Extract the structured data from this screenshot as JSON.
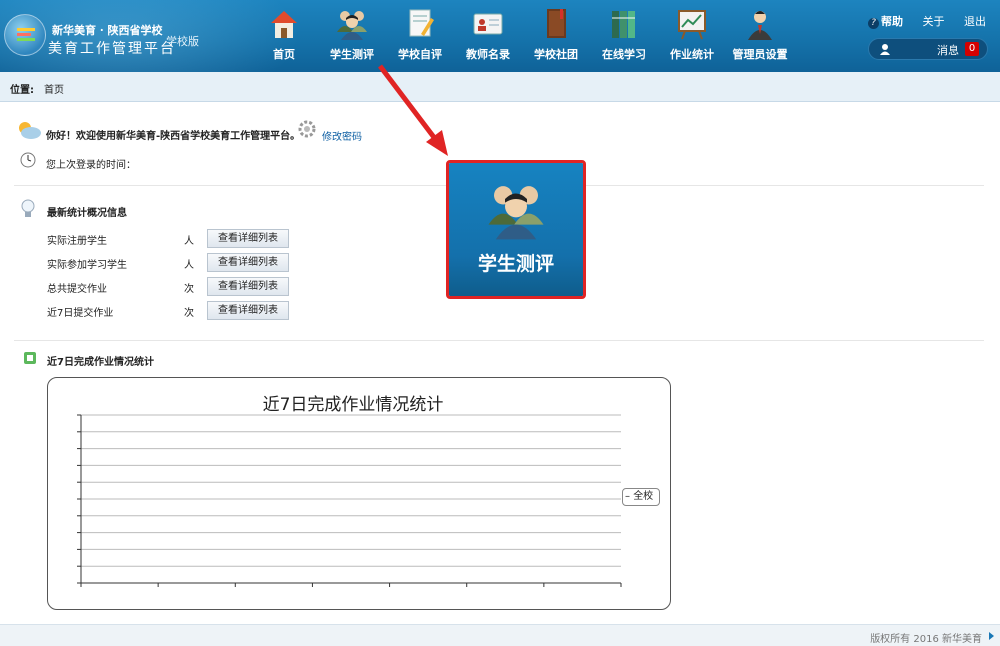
{
  "header": {
    "brand_line1": "新华美育 · 陕西省学校",
    "brand_line2": "美育工作管理平台",
    "edition": "学校版",
    "nav": [
      {
        "label": "首页",
        "icon": "home-icon"
      },
      {
        "label": "学生测评",
        "icon": "students-icon"
      },
      {
        "label": "学校自评",
        "icon": "self-evaluation-icon"
      },
      {
        "label": "教师名录",
        "icon": "teacher-card-icon"
      },
      {
        "label": "学校社团",
        "icon": "club-book-icon"
      },
      {
        "label": "在线学习",
        "icon": "books-icon"
      },
      {
        "label": "作业统计",
        "icon": "statistics-board-icon"
      },
      {
        "label": "管理员设置",
        "icon": "admin-person-icon"
      }
    ],
    "help": "帮助",
    "about": "关于",
    "logout": "退出",
    "messages_label": "消息",
    "messages_count": "0"
  },
  "breadcrumb": {
    "label": "位置:",
    "value": "首页"
  },
  "welcome": {
    "greeting": "你好！欢迎使用新华美育-陕西省学校美育工作管理平台。",
    "change_password": "修改密码",
    "last_login": "您上次登录的时间："
  },
  "stats": {
    "title": "最新统计概况信息",
    "rows": [
      {
        "label": "实际注册学生",
        "unit": "人",
        "button": "查看详细列表"
      },
      {
        "label": "实际参加学习学生",
        "unit": "人",
        "button": "查看详细列表"
      },
      {
        "label": "总共提交作业",
        "unit": "次",
        "button": "查看详细列表"
      },
      {
        "label": "近7日提交作业",
        "unit": "次",
        "button": "查看详细列表"
      }
    ]
  },
  "chart_section": {
    "title": "近7日完成作业情况统计"
  },
  "chart_data": {
    "type": "line",
    "title": "近7日完成作业情况统计",
    "series": [
      {
        "name": "全校",
        "values": []
      }
    ],
    "x": [],
    "grid": true,
    "legend": "right"
  },
  "callout": {
    "label": "学生测评",
    "icon": "students-icon",
    "border_color": "#e02424"
  },
  "footer": {
    "copyright": "版权所有 2016 新华美育"
  },
  "colors": {
    "header": "#1573ab",
    "accent_red": "#e02424",
    "link": "#0d5fa3"
  }
}
